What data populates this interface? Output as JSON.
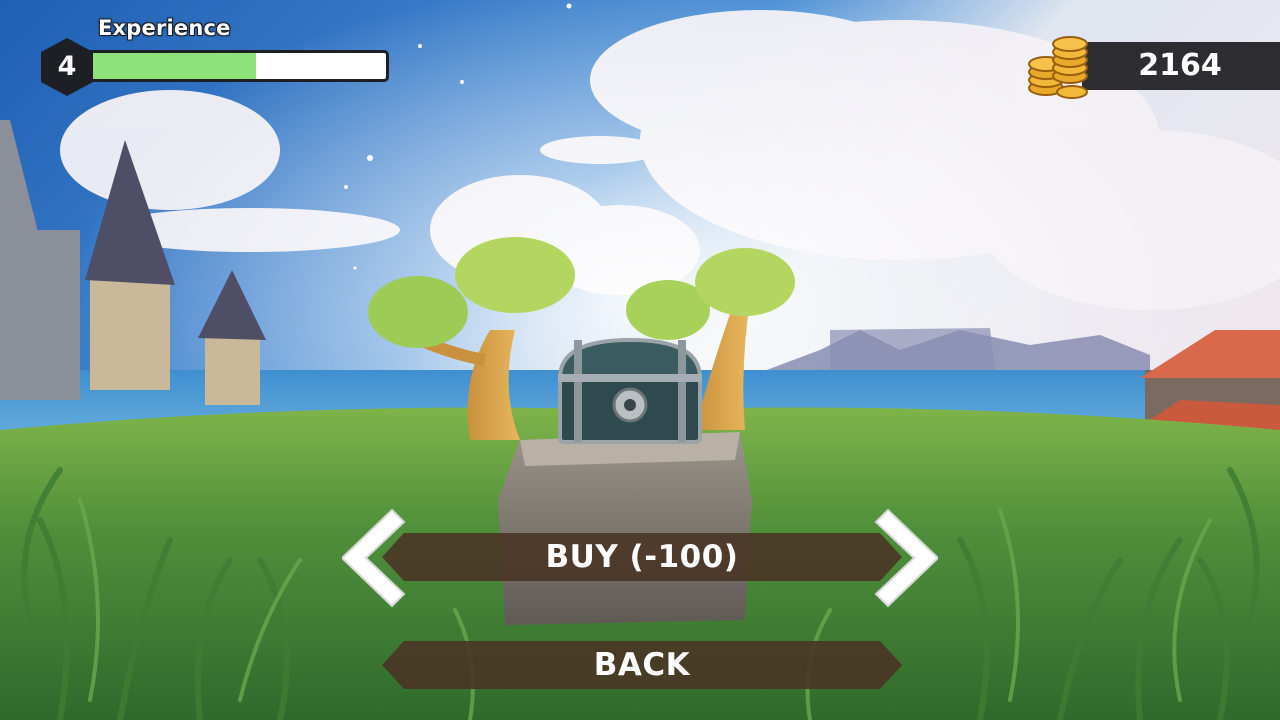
{
  "hud": {
    "experience_label": "Experience",
    "level": "4",
    "xp_fraction": 0.57,
    "coins": "2164"
  },
  "menu": {
    "buy_label": "BUY (-100)",
    "back_label": "BACK"
  },
  "icons": {
    "prev": "chevron-left-icon",
    "next": "chevron-right-icon",
    "coins": "coin-stack-icon",
    "level": "hexagon-level-icon"
  },
  "colors": {
    "xp_fill": "#8fe17a",
    "button_bg": "#4a3526",
    "coin_gold": "#e8a92a",
    "hud_dark": "#2c2c31"
  }
}
